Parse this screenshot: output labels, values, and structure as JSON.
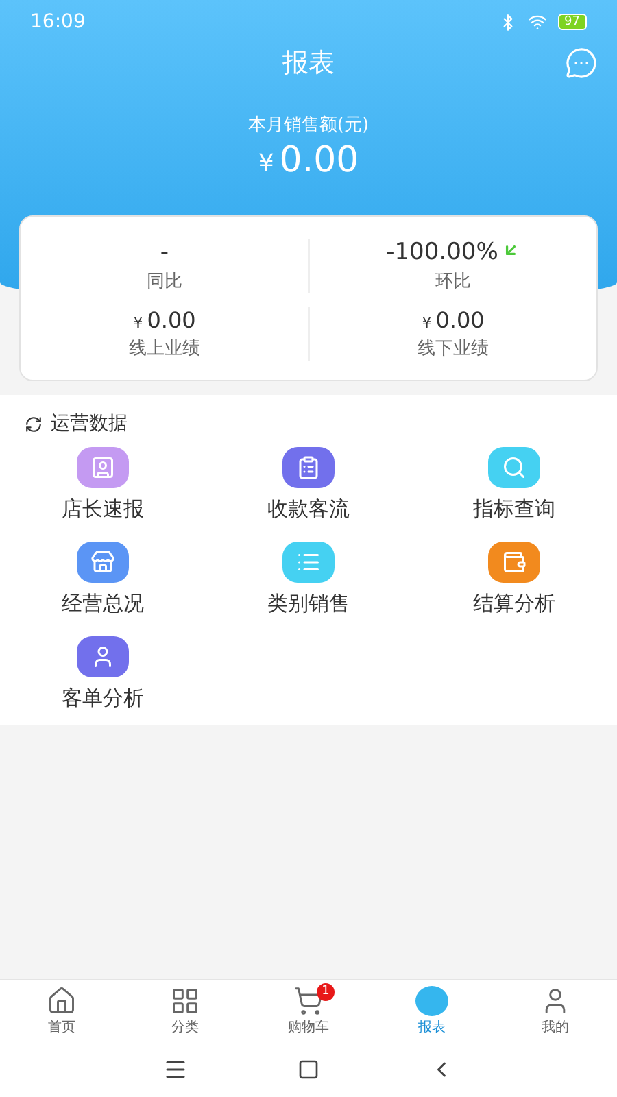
{
  "status_bar": {
    "time": "16:09",
    "battery": "97"
  },
  "header": {
    "title": "报表",
    "subtitle": "本月销售额(元)",
    "currency": "¥",
    "amount": "0.00"
  },
  "stats": [
    {
      "value": "-",
      "label": "同比",
      "falling": false
    },
    {
      "value": "-100.00%",
      "label": "环比",
      "falling": true
    },
    {
      "currency": "¥",
      "value": "0.00",
      "label": "线上业绩",
      "falling": false
    },
    {
      "currency": "¥",
      "value": "0.00",
      "label": "线下业绩",
      "falling": false
    }
  ],
  "section": {
    "title": "运营数据",
    "items": [
      {
        "label": "店长速报",
        "color": "#c49af2"
      },
      {
        "label": "收款客流",
        "color": "#7270ec"
      },
      {
        "label": "指标查询",
        "color": "#45d1f2"
      },
      {
        "label": "经营总况",
        "color": "#5b95f5"
      },
      {
        "label": "类别销售",
        "color": "#45d1f2"
      },
      {
        "label": "结算分析",
        "color": "#f28a1e"
      },
      {
        "label": "客单分析",
        "color": "#7270ec"
      }
    ]
  },
  "tabs": [
    {
      "label": "首页",
      "selected": false
    },
    {
      "label": "分类",
      "selected": false
    },
    {
      "label": "购物车",
      "selected": false,
      "badge": "1"
    },
    {
      "label": "报表",
      "selected": true
    },
    {
      "label": "我的",
      "selected": false
    }
  ]
}
